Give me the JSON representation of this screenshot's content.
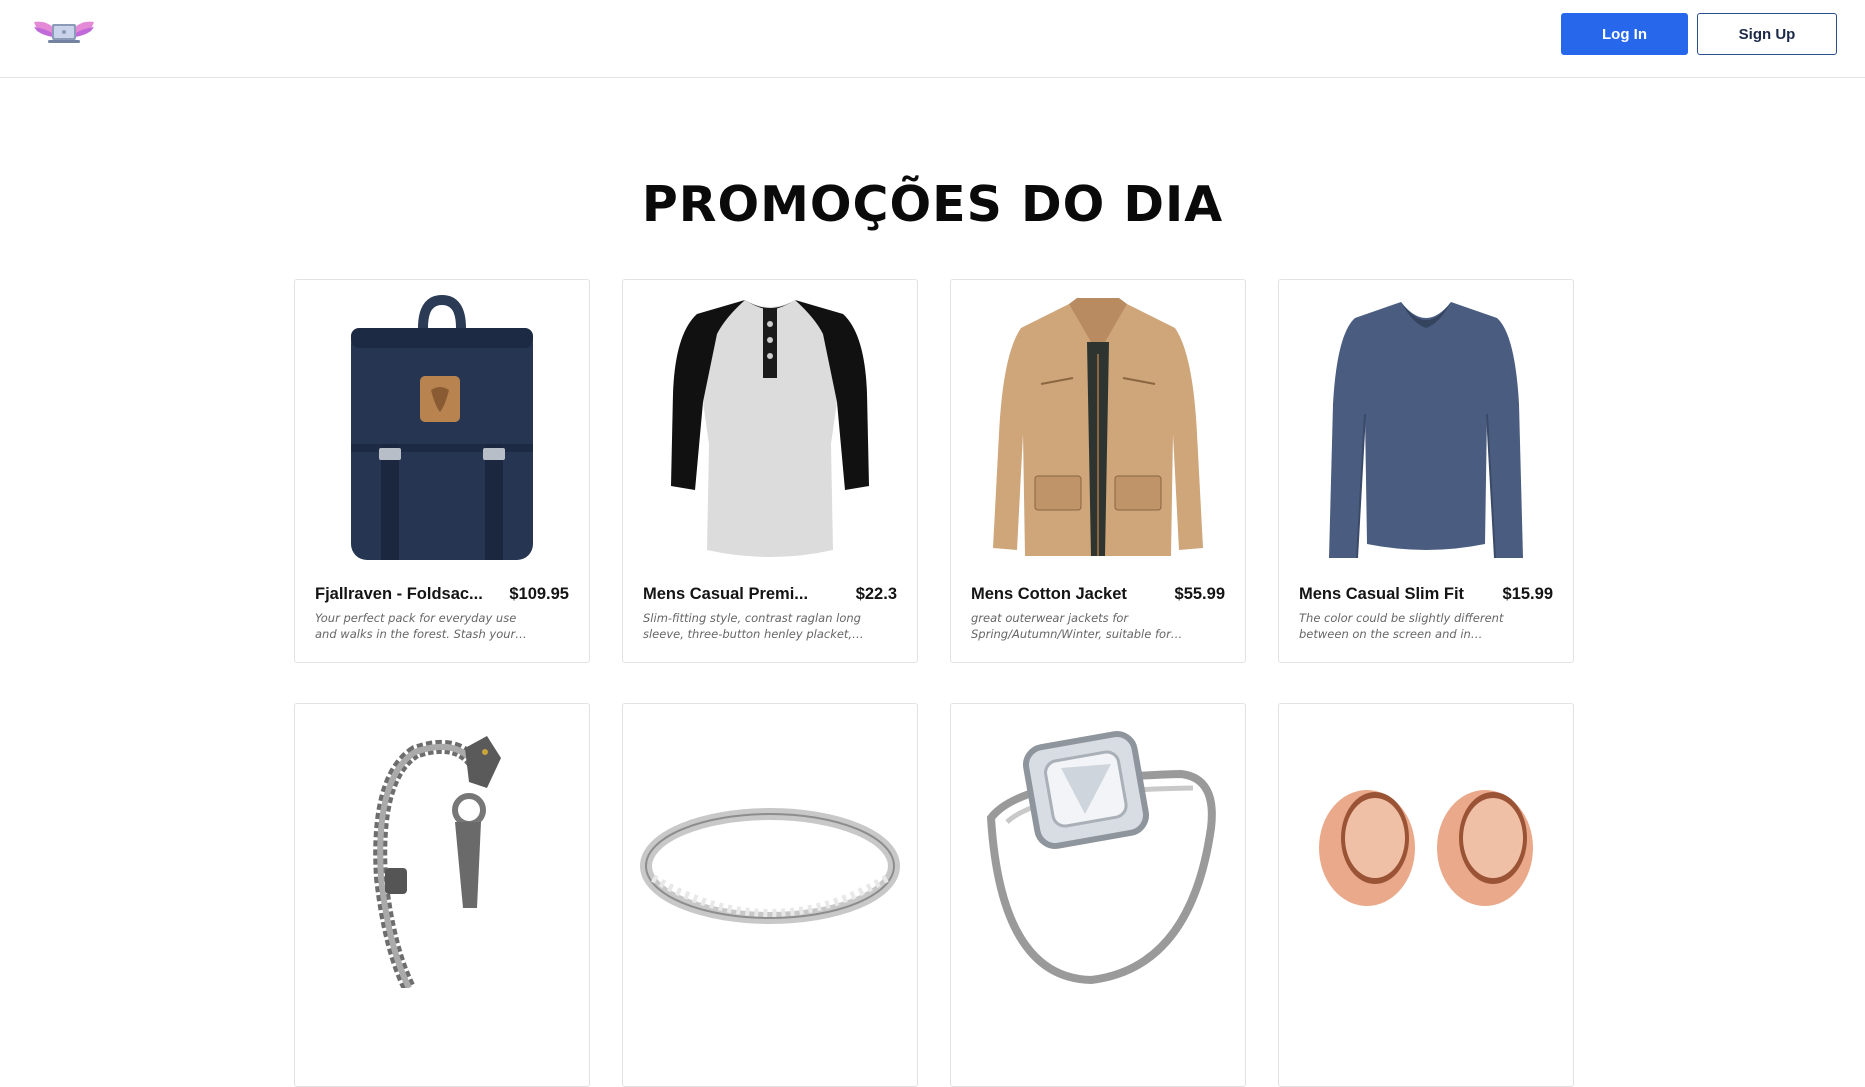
{
  "header": {
    "logo_icon": "laptop-with-wings-logo",
    "login_label": "Log In",
    "signup_label": "Sign Up",
    "accent_color": "#2667eb"
  },
  "main": {
    "title": "PROMOÇÕES DO DIA"
  },
  "products": [
    {
      "title": "Fjallraven - Foldsac...",
      "price": "$109.95",
      "description": "Your perfect pack for everyday use and walks in the forest. Stash your laptop (up...",
      "image_icon": "navy-backpack"
    },
    {
      "title": "Mens Casual Premi...",
      "price": "$22.3",
      "description": "Slim-fitting style, contrast raglan long sleeve, three-button henley placket, light...",
      "image_icon": "raglan-henley-shirt"
    },
    {
      "title": "Mens Cotton Jacket",
      "price": "$55.99",
      "description": "great outerwear jackets for Spring/Autumn/Winter, suitable for man...",
      "image_icon": "tan-cotton-jacket"
    },
    {
      "title": "Mens Casual Slim Fit",
      "price": "$15.99",
      "description": "The color could be slightly different between on the screen and in practice. /...",
      "image_icon": "blue-long-sleeve-tee"
    },
    {
      "title": "",
      "price": "",
      "description": "",
      "image_icon": "silver-dragon-bracelet"
    },
    {
      "title": "",
      "price": "",
      "description": "",
      "image_icon": "silver-band-ring"
    },
    {
      "title": "",
      "price": "",
      "description": "",
      "image_icon": "diamond-engagement-ring"
    },
    {
      "title": "",
      "price": "",
      "description": "",
      "image_icon": "rose-gold-tunnel-plugs"
    }
  ]
}
